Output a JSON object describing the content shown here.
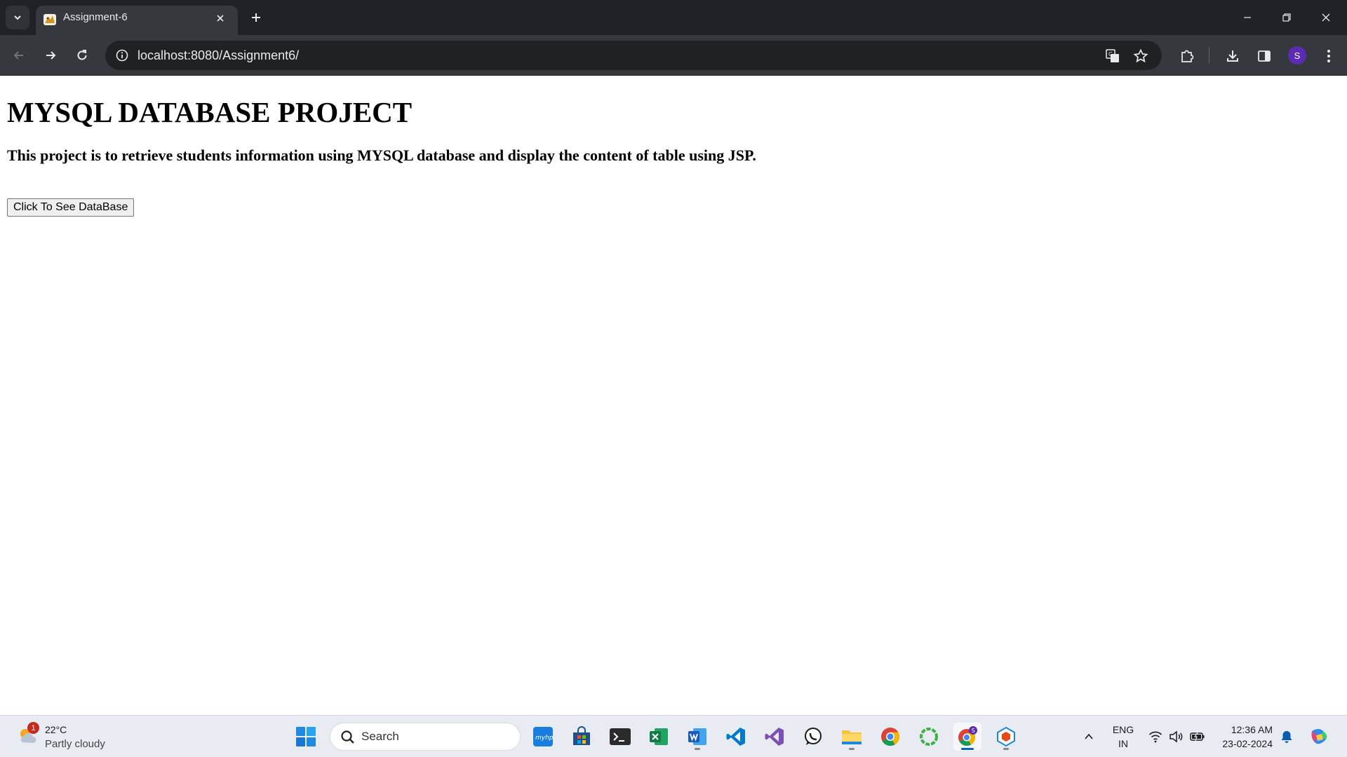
{
  "browser": {
    "tab_title": "Assignment-6",
    "url": "localhost:8080/Assignment6/",
    "profile_initial": "S"
  },
  "page": {
    "heading": "MYSQL DATABASE PROJECT",
    "description": "This project is to retrieve students information using MYSQL database and display the content of table using JSP.",
    "button_label": "Click To See DataBase"
  },
  "taskbar": {
    "weather": {
      "temperature": "22°C",
      "condition": "Partly cloudy",
      "badge": "1"
    },
    "search_placeholder": "Search",
    "chrome_badge": "S",
    "language": {
      "line1": "ENG",
      "line2": "IN"
    },
    "clock": {
      "time": "12:36 AM",
      "date": "23-02-2024"
    }
  },
  "colors": {
    "tabstrip": "#1f2327",
    "toolbar": "#35393d",
    "omnibox": "#202124",
    "profile": "#5b2bb3",
    "taskbar": "#e9ebf2"
  }
}
